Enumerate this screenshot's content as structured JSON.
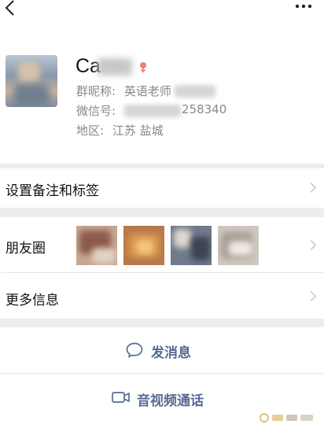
{
  "nav": {
    "back_glyph": "<",
    "more_glyph": "···"
  },
  "profile": {
    "name": "Ca",
    "group_nickname_label": "群昵称:",
    "group_nickname_value": "英语老师",
    "wechat_id_label": "微信号:",
    "wechat_id_value": "258340",
    "region_label": "地区:",
    "region_value": "江苏  盐城"
  },
  "rows": {
    "remark": "设置备注和标签",
    "moments": "朋友圈",
    "more_info": "更多信息"
  },
  "actions": {
    "message": "发消息",
    "call": "音视频通话"
  },
  "colors": {
    "link": "#576b95",
    "gender_female": "#f37e7d",
    "background": "#ededed"
  }
}
